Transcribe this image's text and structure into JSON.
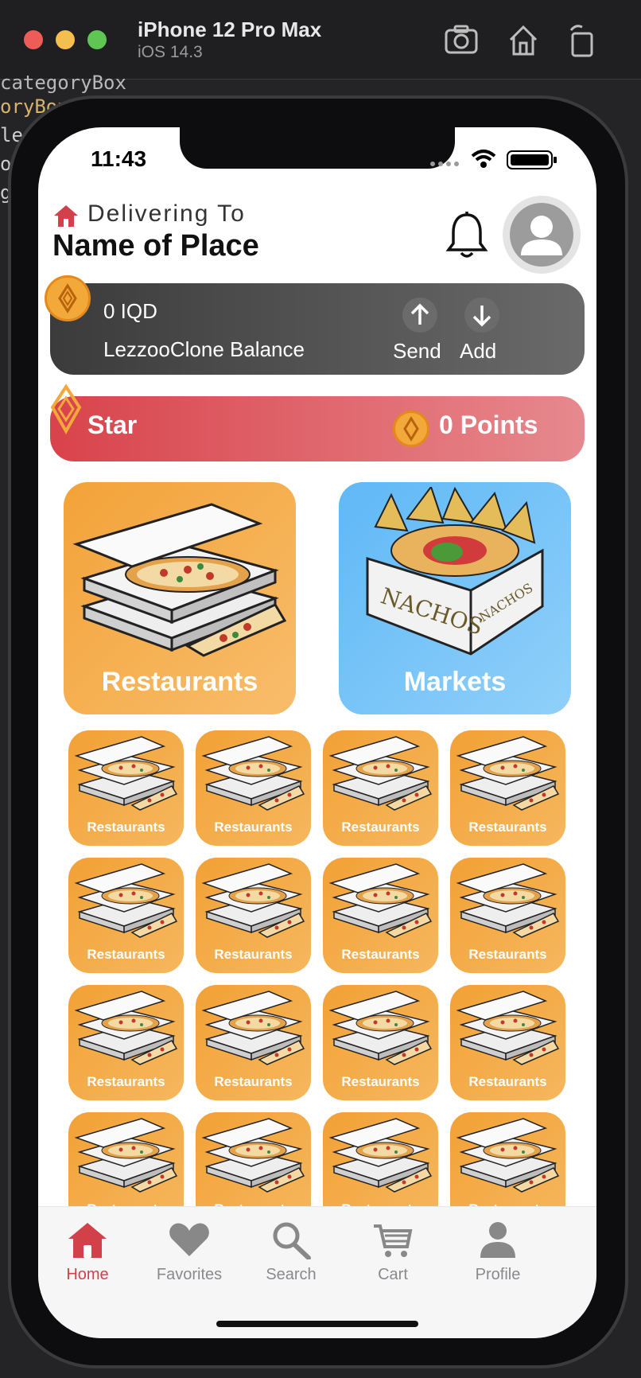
{
  "simulator": {
    "device": "iPhone 12 Pro Max",
    "os": "iOS 14.3"
  },
  "status_bar": {
    "time": "11:43"
  },
  "header": {
    "delivering_label": "Delivering To",
    "place_name": "Name of Place"
  },
  "balance": {
    "amount": "0 IQD",
    "label": "LezzooClone Balance",
    "send_label": "Send",
    "add_label": "Add"
  },
  "star": {
    "label": "Star",
    "points": "0 Points"
  },
  "categories": {
    "restaurants": "Restaurants",
    "markets": "Markets"
  },
  "grid_items": [
    {
      "label": "Restaurants"
    },
    {
      "label": "Restaurants"
    },
    {
      "label": "Restaurants"
    },
    {
      "label": "Restaurants"
    },
    {
      "label": "Restaurants"
    },
    {
      "label": "Restaurants"
    },
    {
      "label": "Restaurants"
    },
    {
      "label": "Restaurants"
    },
    {
      "label": "Restaurants"
    },
    {
      "label": "Restaurants"
    },
    {
      "label": "Restaurants"
    },
    {
      "label": "Restaurants"
    },
    {
      "label": "Restaurants"
    },
    {
      "label": "Restaurants"
    },
    {
      "label": "Restaurants"
    },
    {
      "label": "Restaurants"
    }
  ],
  "tabs": [
    {
      "label": "Home",
      "icon": "home-icon",
      "active": true
    },
    {
      "label": "Favorites",
      "icon": "heart-icon",
      "active": false
    },
    {
      "label": "Search",
      "icon": "search-icon",
      "active": false
    },
    {
      "label": "Cart",
      "icon": "cart-icon",
      "active": false
    },
    {
      "label": "Profile",
      "icon": "person-icon",
      "active": false
    }
  ],
  "colors": {
    "accent_red": "#d2414a",
    "coin_orange": "#f3a83a",
    "restaurant_tile": "#f2a135",
    "market_tile": "#5fb8f6"
  }
}
